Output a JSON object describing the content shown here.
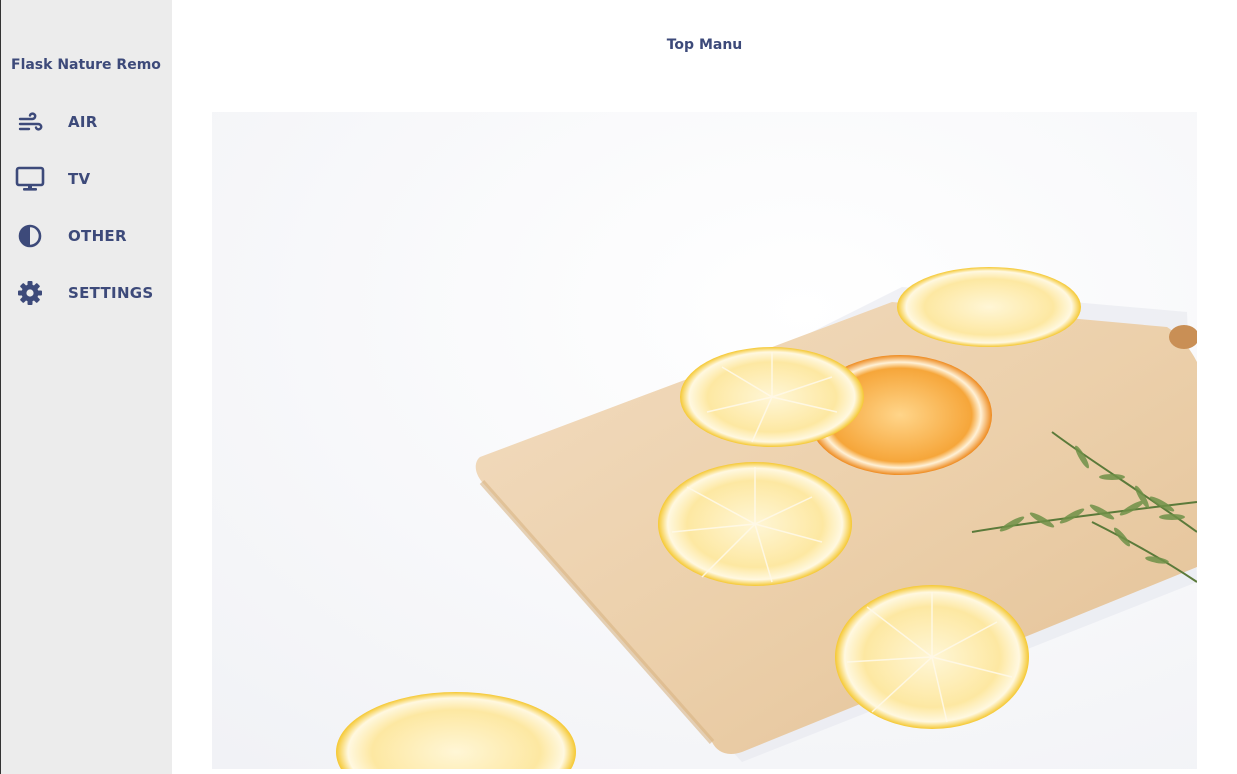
{
  "sidebar": {
    "brand": "Flask Nature Remo",
    "items": [
      {
        "label": "AIR",
        "icon": "wind-icon"
      },
      {
        "label": "TV",
        "icon": "monitor-icon"
      },
      {
        "label": "OTHER",
        "icon": "contrast-icon"
      },
      {
        "label": "SETTINGS",
        "icon": "gear-icon"
      }
    ]
  },
  "main": {
    "title": "Top Manu"
  },
  "colors": {
    "accent": "#3d4a7a",
    "sidebar_bg": "#ececec"
  }
}
